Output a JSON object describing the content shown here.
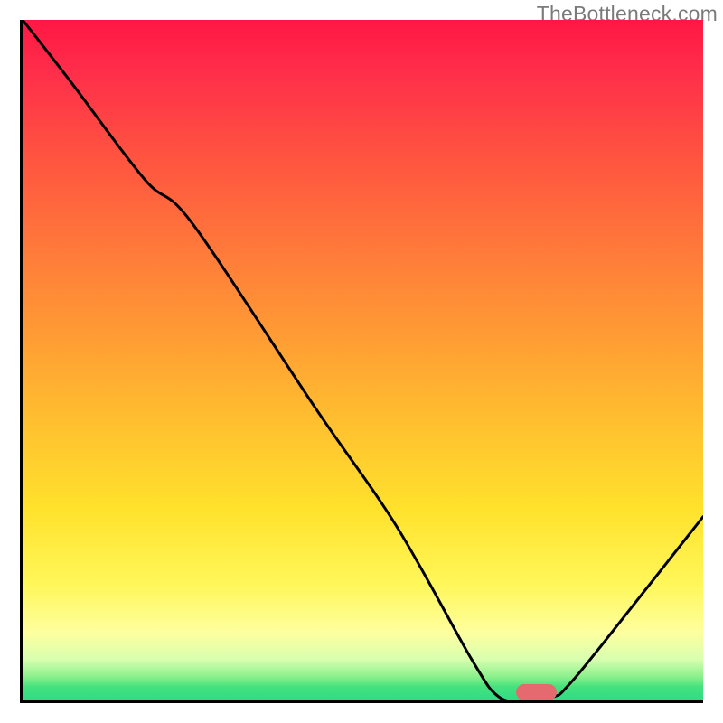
{
  "watermark": "TheBottleneck.com",
  "chart_data": {
    "type": "line",
    "title": "",
    "xlabel": "",
    "ylabel": "",
    "x": [
      0,
      7,
      18,
      25,
      43,
      55,
      66,
      70,
      74,
      78,
      80,
      85,
      100
    ],
    "values": [
      100,
      91,
      76.5,
      70,
      43,
      25.5,
      6,
      0.5,
      0,
      0.5,
      2,
      8,
      27
    ],
    "xlim": [
      0,
      100
    ],
    "ylim": [
      0,
      100
    ],
    "marker": {
      "x_center": 75.5,
      "width_pct": 6,
      "y": 0
    },
    "colors": {
      "curve": "#000000",
      "marker": "#e46a6f",
      "gradient_top": "#ff1744",
      "gradient_bottom": "#2fdc84"
    }
  }
}
